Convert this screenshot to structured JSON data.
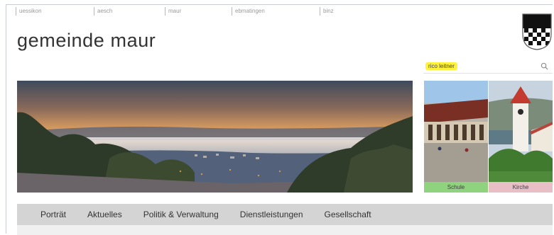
{
  "top_links": [
    "uessikon",
    "aesch",
    "maur",
    "ebmatingen",
    "binz"
  ],
  "site": {
    "title": "gemeinde maur"
  },
  "search": {
    "query": "rico leitner",
    "icon": "search-icon"
  },
  "tiles": [
    {
      "caption": "Schule",
      "color": "#8fd37f"
    },
    {
      "caption": "Kirche",
      "color": "#e8bfc7"
    }
  ],
  "main_nav": [
    "Porträt",
    "Aktuelles",
    "Politik & Verwaltung",
    "Dienstleistungen",
    "Gesellschaft"
  ],
  "colors": {
    "nav_bg": "#d4d4d4",
    "highlight": "#fff23a",
    "title": "#333333"
  }
}
